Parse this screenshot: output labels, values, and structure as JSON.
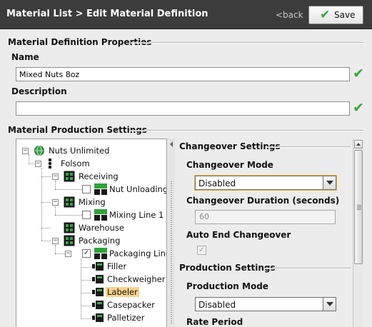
{
  "header": {
    "title": "Material List > Edit Material Definition",
    "back_label": "<back",
    "save_label": "Save"
  },
  "properties": {
    "section_title": "Material Definition Properties",
    "name_label": "Name",
    "name_value": "Mixed Nuts 8oz",
    "description_label": "Description",
    "description_value": ""
  },
  "production": {
    "section_title": "Material Production Settings"
  },
  "tree": {
    "nodes": [
      {
        "label": "Nuts Unlimited",
        "kind": "enterprise"
      },
      {
        "label": "Folsom",
        "kind": "site"
      },
      {
        "label": "Receiving",
        "kind": "area"
      },
      {
        "label": "Nut Unloading",
        "kind": "line",
        "checked": false
      },
      {
        "label": "Mixing",
        "kind": "area"
      },
      {
        "label": "Mixing Line 1",
        "kind": "line",
        "checked": false
      },
      {
        "label": "Warehouse",
        "kind": "area"
      },
      {
        "label": "Packaging",
        "kind": "area"
      },
      {
        "label": "Packaging Line",
        "kind": "line",
        "checked": true
      },
      {
        "label": "Filler",
        "kind": "cell"
      },
      {
        "label": "Checkweigher",
        "kind": "cell"
      },
      {
        "label": "Labeler",
        "kind": "cell",
        "selected": true
      },
      {
        "label": "Casepacker",
        "kind": "cell"
      },
      {
        "label": "Palletizer",
        "kind": "cell"
      }
    ]
  },
  "changeover": {
    "section_title": "Changeover Settings",
    "mode_label": "Changeover Mode",
    "mode_value": "Disabled",
    "duration_label": "Changeover Duration (seconds)",
    "duration_value": "60",
    "auto_end_label": "Auto End Changeover",
    "auto_end_checked": true
  },
  "production_settings": {
    "section_title": "Production Settings",
    "mode_label": "Production Mode",
    "mode_value": "Disabled",
    "rate_period_label": "Rate Period"
  },
  "colors": {
    "header_bg": "#3c3c3c",
    "accent_green": "#3ba53f",
    "selection_highlight": "#f7d38c"
  }
}
